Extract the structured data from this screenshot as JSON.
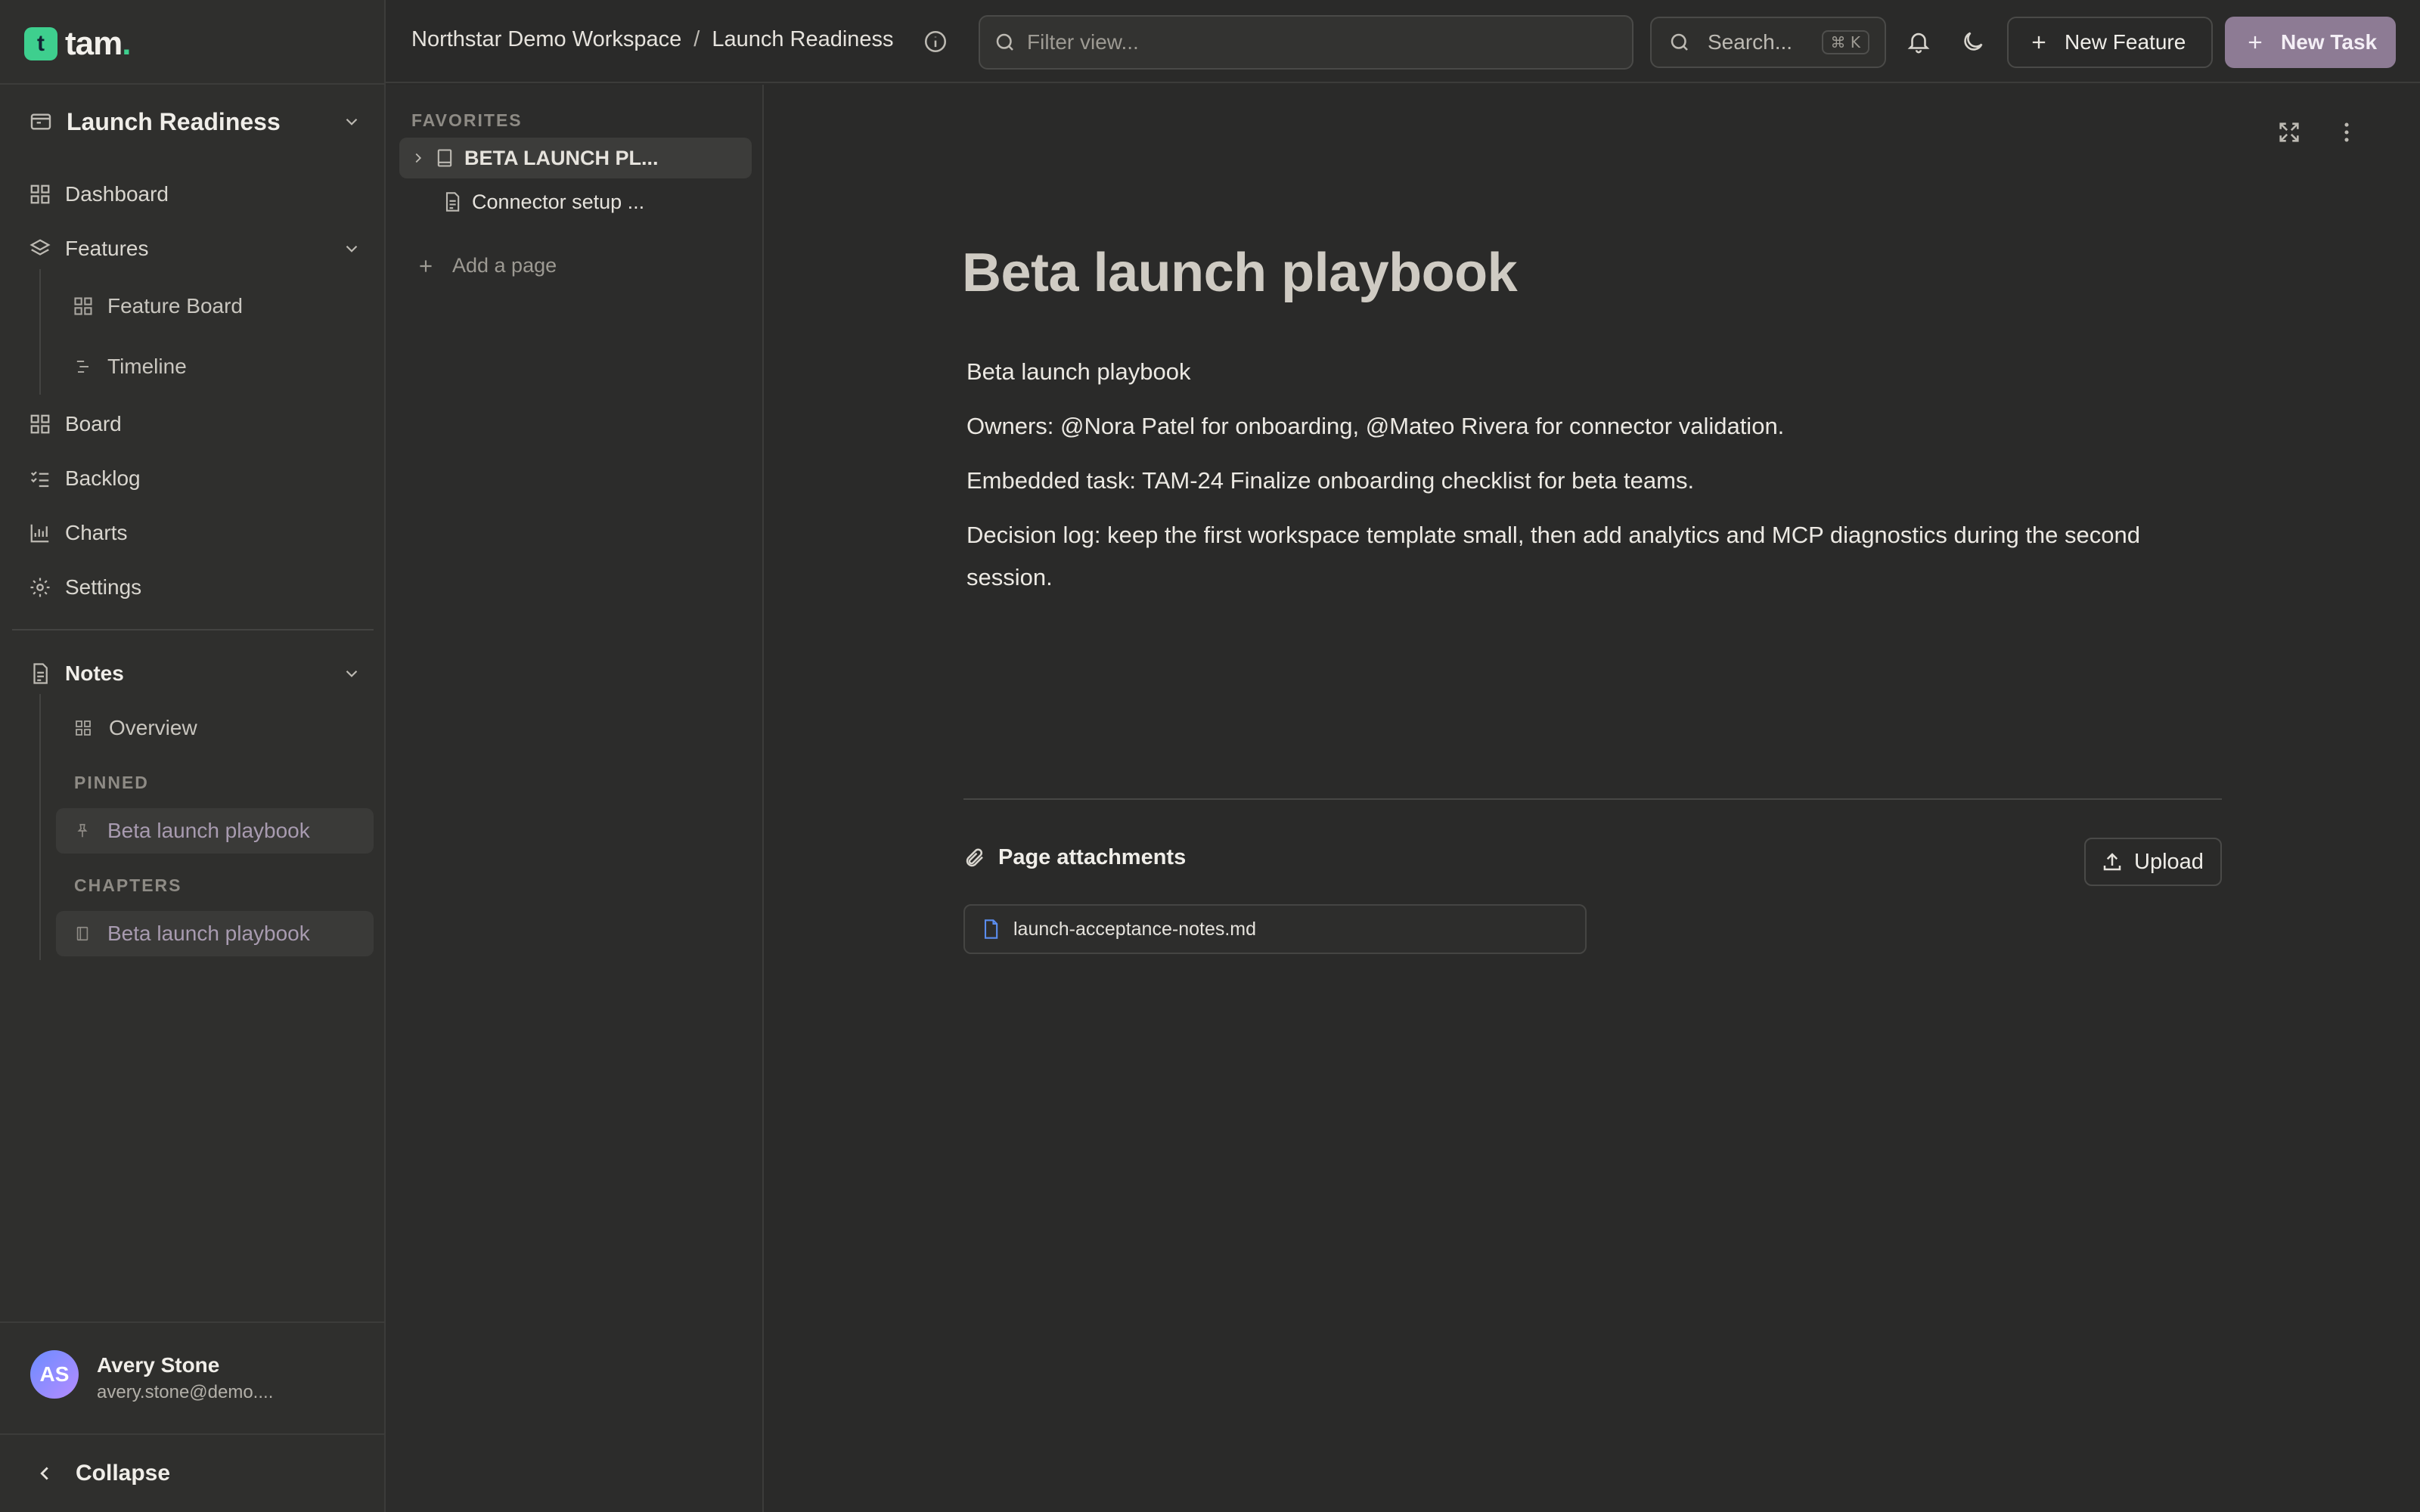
{
  "brand": {
    "logo_letter": "t",
    "name": "tam",
    "dot": "."
  },
  "sidebar": {
    "project": "Launch Readiness",
    "nav": [
      {
        "label": "Dashboard",
        "icon": "grid-icon"
      },
      {
        "label": "Features",
        "icon": "layers-icon"
      },
      {
        "label": "Feature Board",
        "icon": "grid-icon"
      },
      {
        "label": "Timeline",
        "icon": "timeline-icon"
      },
      {
        "label": "Board",
        "icon": "grid-icon"
      },
      {
        "label": "Backlog",
        "icon": "list-check-icon"
      },
      {
        "label": "Charts",
        "icon": "chart-icon"
      },
      {
        "label": "Settings",
        "icon": "gear-icon"
      }
    ],
    "notes": {
      "label": "Notes",
      "overview": "Overview",
      "pinned_caption": "PINNED",
      "pinned_item": "Beta launch playbook",
      "chapters_caption": "CHAPTERS",
      "chapter_item": "Beta launch playbook"
    },
    "user": {
      "initials": "AS",
      "name": "Avery Stone",
      "email": "avery.stone@demo...."
    },
    "collapse_label": "Collapse"
  },
  "topbar": {
    "breadcrumb": [
      "Northstar Demo Workspace",
      "Launch Readiness"
    ],
    "breadcrumb_sep": "/",
    "filter_placeholder": "Filter view...",
    "search_label": "Search...",
    "search_shortcut": "⌘ K",
    "new_feature": "New Feature",
    "new_task": "New Task"
  },
  "pages": {
    "favorites_caption": "FAVORITES",
    "items": [
      "BETA LAUNCH PL...",
      "Connector setup ..."
    ],
    "add_page": "Add a page"
  },
  "document": {
    "title": "Beta launch playbook",
    "paragraphs": [
      "Beta launch playbook",
      "Owners: @Nora Patel for onboarding, @Mateo Rivera for connector validation.",
      "Embedded task: TAM-24 Finalize onboarding checklist for beta teams.",
      "Decision log: keep the first workspace template small, then add analytics and MCP diagnostics during the second session."
    ],
    "attachments_label": "Page attachments",
    "upload_label": "Upload",
    "files": [
      "launch-acceptance-notes.md"
    ]
  },
  "colors": {
    "accent": "#3ecf8e",
    "primary_button": "#8d7b94",
    "active_note_text": "#a89bb0",
    "file_icon": "#5b8def"
  }
}
